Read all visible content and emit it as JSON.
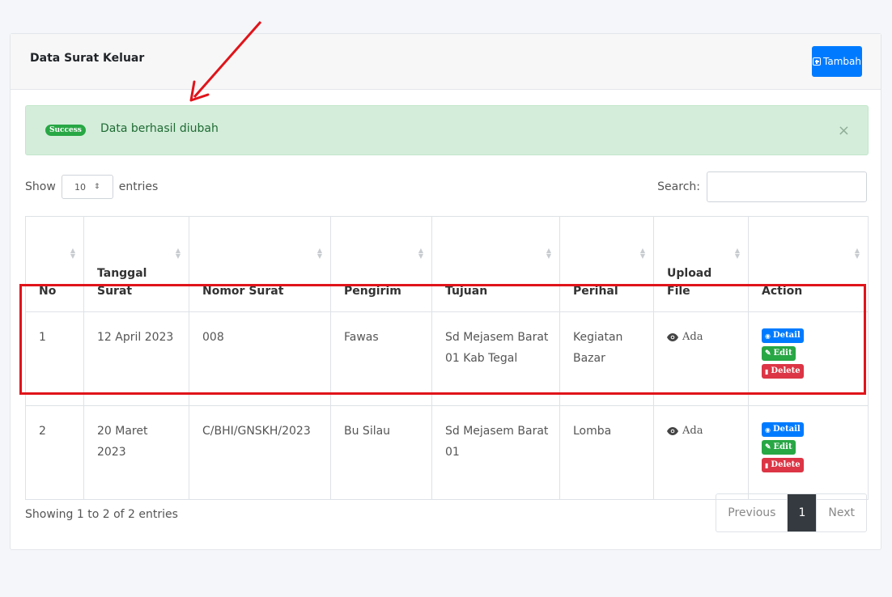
{
  "card": {
    "title": "Data Surat Keluar",
    "add_button_label": "Tambah"
  },
  "alert": {
    "badge": "Success",
    "message": "Data berhasil diubah",
    "close": "×"
  },
  "controls": {
    "show_label": "Show",
    "entries_value": "10",
    "entries_label": "entries",
    "search_label": "Search:",
    "search_value": ""
  },
  "table": {
    "headers": [
      "No",
      "Tanggal Surat",
      "Nomor Surat",
      "Pengirim",
      "Tujuan",
      "Perihal",
      "Upload File",
      "Action"
    ],
    "rows": [
      {
        "no": "1",
        "tanggal": "12 April 2023",
        "nomor": "008",
        "pengirim": "Fawas",
        "tujuan": "Sd Mejasem Barat 01 Kab Tegal",
        "perihal": "Kegiatan Bazar",
        "upload": "Ada"
      },
      {
        "no": "2",
        "tanggal": "20 Maret 2023",
        "nomor": "C/BHI/GNSKH/2023",
        "pengirim": "Bu Silau",
        "tujuan": "Sd Mejasem Barat 01",
        "perihal": "Lomba",
        "upload": "Ada"
      }
    ],
    "actions": {
      "detail": "Detail",
      "edit": "Edit",
      "delete": "Delete"
    }
  },
  "footer": {
    "info": "Showing 1 to 2 of 2 entries",
    "previous": "Previous",
    "current_page": "1",
    "next": "Next"
  },
  "colors": {
    "primary": "#007bff",
    "success": "#28a745",
    "danger": "#dc3545",
    "annotation_red": "#e0141a"
  }
}
